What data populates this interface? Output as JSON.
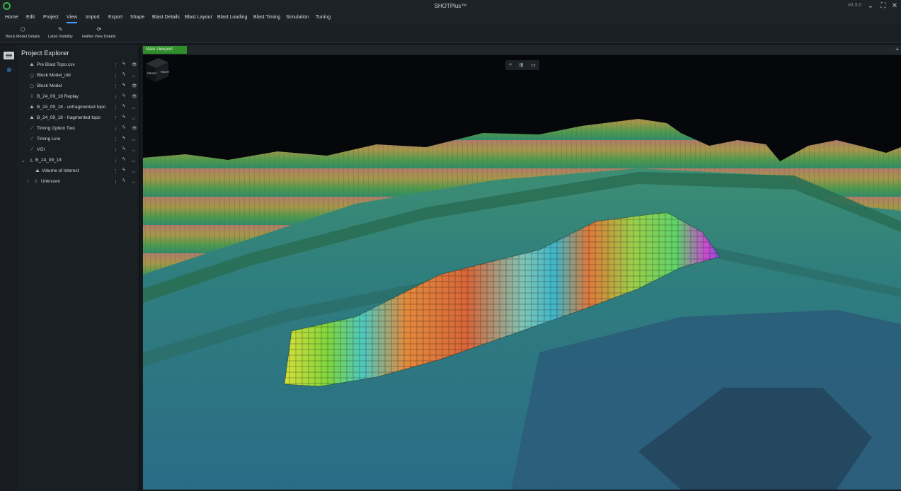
{
  "app": {
    "title": "SHOTPlus™",
    "version": "v0.3.0"
  },
  "window_controls": {
    "minimize": "⌄",
    "restore": "⛶",
    "close": "✕"
  },
  "menu": [
    "Home",
    "Edit",
    "Project",
    "View",
    "Import",
    "Export",
    "Shape",
    "Blast Details",
    "Blast Layout",
    "Blast Loading",
    "Blast Timing",
    "Simulation",
    "Tuning"
  ],
  "active_menu": "View",
  "ribbon": {
    "block_model_details": "Block Model Details",
    "label_visibility": "Label Visibility",
    "halfire_view_details": "Halfire View Details"
  },
  "explorer": {
    "title": "Project Explorer",
    "items": [
      {
        "label": "Pre Blast Topo.csv",
        "icon": "topo-icon",
        "visible": true
      },
      {
        "label": "Block Model_old",
        "icon": "block-model-icon",
        "visible": false
      },
      {
        "label": "Block Model",
        "icon": "block-model-icon",
        "visible": true
      },
      {
        "label": "B_24_09_18 Replay",
        "icon": "replay-icon",
        "visible": true
      },
      {
        "label": "B_24_09_18 - unfragmented topo",
        "icon": "topo-icon",
        "visible": false
      },
      {
        "label": "B_24_09_18 - fragmented topo",
        "icon": "topo-icon",
        "visible": false
      },
      {
        "label": "Timing Option Two",
        "icon": "timing-icon",
        "visible": true
      },
      {
        "label": "Timing Line",
        "icon": "timing-icon",
        "visible": false
      },
      {
        "label": "VOI",
        "icon": "timing-icon",
        "visible": false
      },
      {
        "label": "B_24_09_18",
        "icon": "blast-icon",
        "visible": false
      },
      {
        "label": "Volume of Interest",
        "icon": "topo-icon",
        "visible": false
      },
      {
        "label": "Unknown",
        "icon": "grid-icon",
        "visible": false
      }
    ]
  },
  "viewport": {
    "tab": "Main Viewport",
    "cube_labels": {
      "front": "FRONT",
      "right": "RIGHT"
    }
  },
  "colors": {
    "accent": "#3ea0ff",
    "tab_green": "#2f8e2a"
  }
}
